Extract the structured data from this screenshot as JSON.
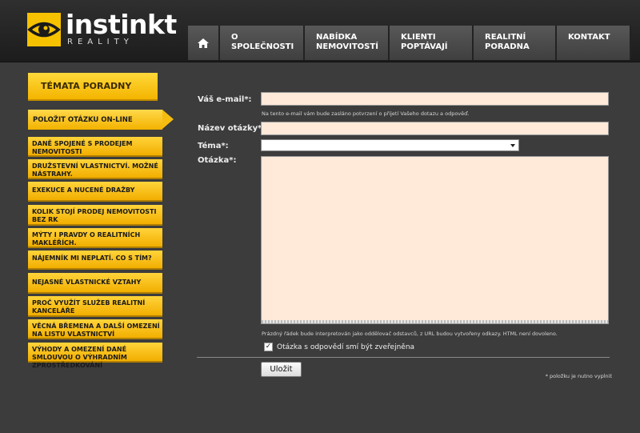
{
  "brand": {
    "name": "instinkt",
    "sub": "REALITY",
    "color": "#f6c200"
  },
  "nav": {
    "home_icon": "home-icon",
    "items": [
      "O SPOLEČNOSTI",
      "NABÍDKA NEMOVITOSTÍ",
      "KLIENTI POPTÁVAJÍ",
      "REALITNÍ PORADNA",
      "KONTAKT"
    ]
  },
  "sidebar": {
    "heading": "TÉMATA PORADNY",
    "active": "POLOŽIT OTÁZKU ON-LINE",
    "items": [
      "DANĚ SPOJENÉ S PRODEJEM NEMOVITOSTI",
      "DRUŽSTEVNÍ VLASTNICTVÍ. MOŽNÉ NÁSTRAHY.",
      "EXEKUCE A NUCENÉ DRAŽBY",
      "KOLIK STOJÍ PRODEJ NEMOVITOSTI BEZ RK",
      "MÝTY I PRAVDY O REALITNÍCH MAKLÉŘÍCH.",
      "NÁJEMNÍK MI NEPLATÍ. CO S TÍM?",
      "NEJASNÉ VLASTNICKÉ VZTAHY",
      "PROČ VYUŽÍT SLUŽEB REALITNÍ KANCELÁŘE",
      "VĚCNÁ BŘEMENA A DALŠÍ OMEZENÍ NA LISTU VLASTNICTVÍ",
      "VÝHODY A OMEZENÍ DANÉ SMLOUVOU O VÝHRADNÍM ZPROSTŘEDKOVÁNÍ"
    ]
  },
  "form": {
    "email_label": "Váš e-mail*:",
    "email_value": "",
    "email_hint": "Na tento e-mail vám bude zasláno potvrzení o přijetí Vašeho dotazu a odpověď.",
    "title_label": "Název otázky*:",
    "title_value": "",
    "topic_label": "Téma*:",
    "topic_value": "",
    "question_label": "Otázka*:",
    "question_value": "",
    "question_hint": "Prázdný řádek bude interpretován jako oddělovač odstavců, z URL budou vytvořeny odkazy. HTML není dovoleno.",
    "publish_checked": true,
    "publish_label": "Otázka s odpovědí smí být zveřejněna",
    "submit_label": "Uložit",
    "required_note": "* položku je nutno vyplnit"
  }
}
